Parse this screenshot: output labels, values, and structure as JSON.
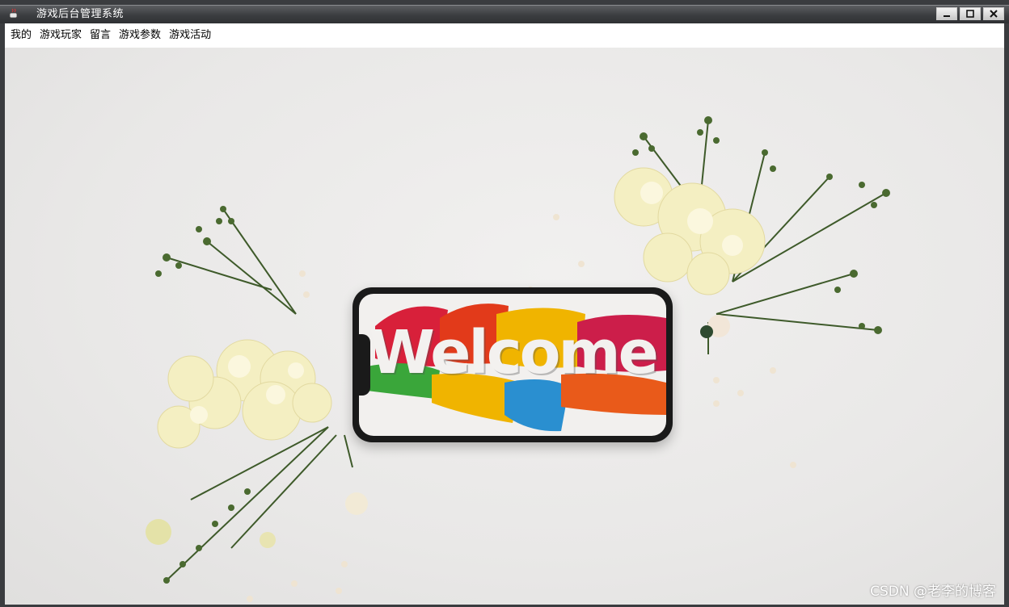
{
  "window": {
    "title": "游戏后台管理系统",
    "controls": [
      "minimize",
      "maximize",
      "close"
    ]
  },
  "menu": {
    "items": [
      "我的",
      "游戏玩家",
      "留言",
      "游戏参数",
      "游戏活动"
    ]
  },
  "content": {
    "phone_text": "Welcome"
  },
  "watermark": "CSDN @老李的博客",
  "colors": {
    "titlebar": "#3b3d40",
    "background": "#ebe9e8",
    "paint_red": "#d8203a",
    "paint_yellow": "#f0b400",
    "paint_blue": "#2a8fd0",
    "paint_green": "#3aa63a",
    "paint_orange": "#e95a1a"
  }
}
